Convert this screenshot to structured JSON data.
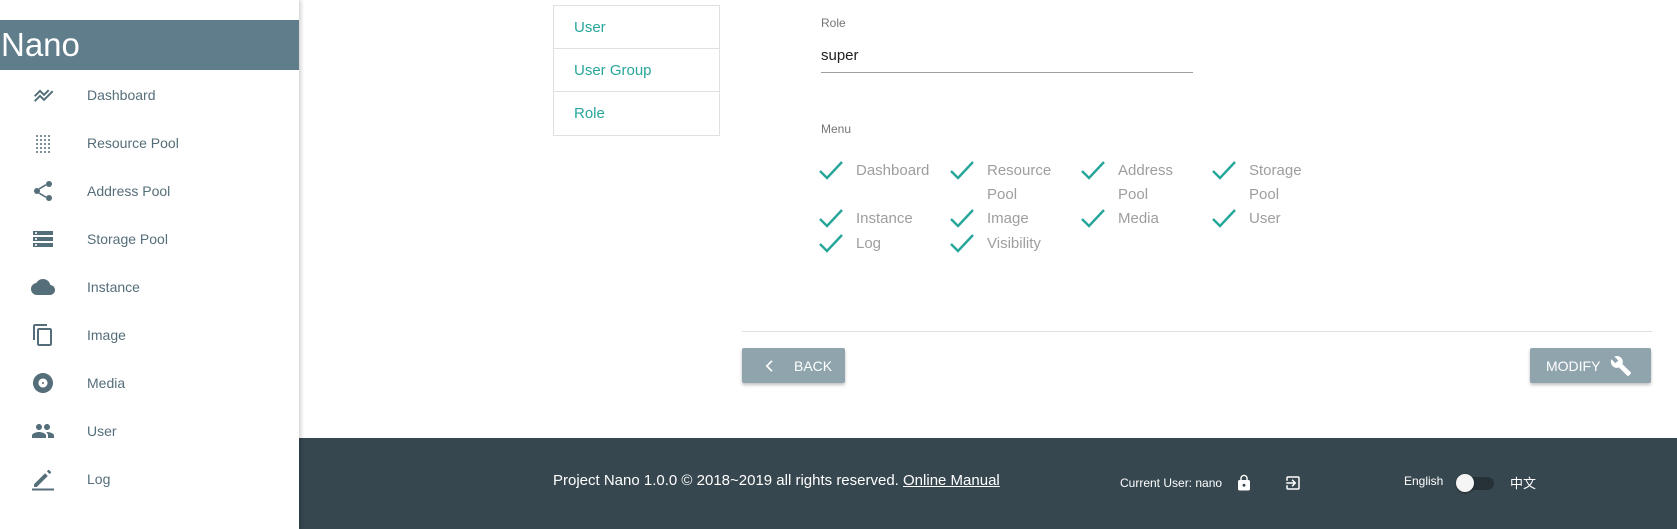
{
  "brand": {
    "title": "Nano",
    "color": "#607d8b"
  },
  "sidebar": {
    "items": [
      {
        "label": "Dashboard",
        "icon": "trending-icon"
      },
      {
        "label": "Resource Pool",
        "icon": "grid-dots-icon"
      },
      {
        "label": "Address Pool",
        "icon": "share-icon"
      },
      {
        "label": "Storage Pool",
        "icon": "storage-icon"
      },
      {
        "label": "Instance",
        "icon": "cloud-icon"
      },
      {
        "label": "Image",
        "icon": "copy-icon"
      },
      {
        "label": "Media",
        "icon": "disc-icon"
      },
      {
        "label": "User",
        "icon": "people-icon"
      },
      {
        "label": "Log",
        "icon": "edit-icon"
      }
    ]
  },
  "subnav": {
    "items": [
      {
        "label": "User"
      },
      {
        "label": "User Group"
      },
      {
        "label": "Role"
      }
    ]
  },
  "form": {
    "role_label": "Role",
    "role_value": "super",
    "menu_label": "Menu",
    "menus": [
      {
        "label": "Dashboard",
        "checked": true
      },
      {
        "label": "Resource Pool",
        "checked": true
      },
      {
        "label": "Address Pool",
        "checked": true
      },
      {
        "label": "Storage Pool",
        "checked": true
      },
      {
        "label": "Instance",
        "checked": true
      },
      {
        "label": "Image",
        "checked": true
      },
      {
        "label": "Media",
        "checked": true
      },
      {
        "label": "User",
        "checked": true
      },
      {
        "label": "Log",
        "checked": true
      },
      {
        "label": "Visibility",
        "checked": true
      }
    ]
  },
  "actions": {
    "back_label": "BACK",
    "modify_label": "MODIFY"
  },
  "footer": {
    "copyright": "Project Nano 1.0.0 © 2018~2019 all rights reserved.",
    "manual_link": "Online Manual",
    "current_user": "Current User: nano",
    "lang_en": "English",
    "lang_zh": "中文"
  },
  "colors": {
    "accent": "#26a69a",
    "button": "#90a4ae",
    "footer": "#37474f"
  }
}
